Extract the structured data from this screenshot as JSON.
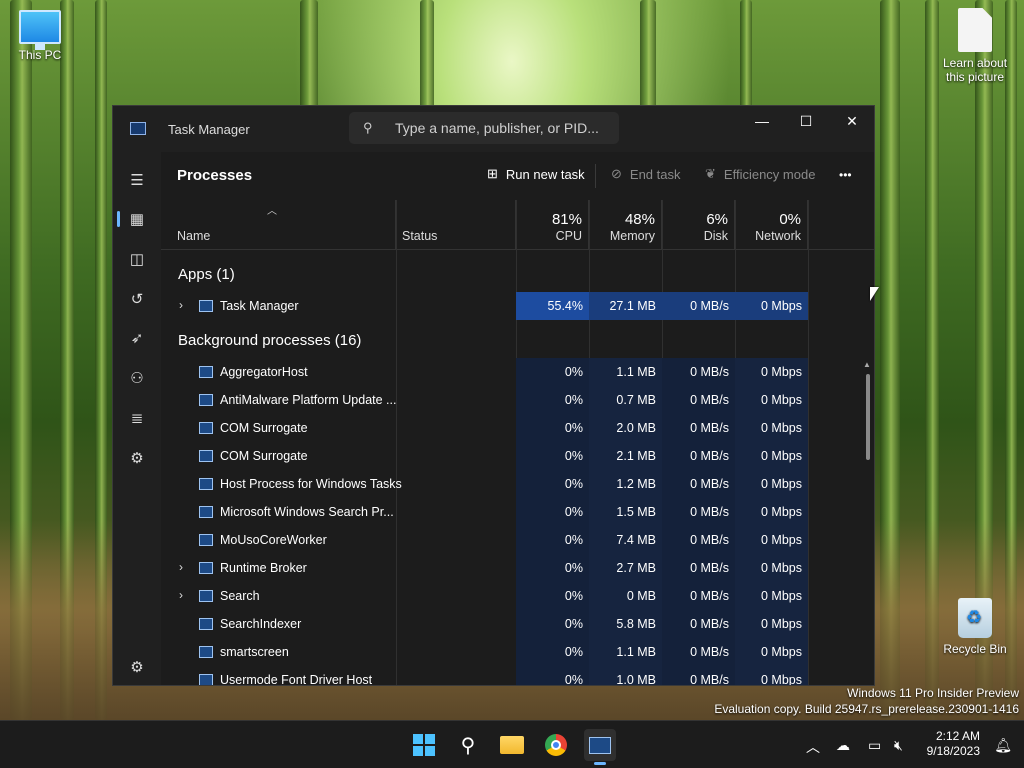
{
  "desktop": {
    "icons": [
      {
        "label": "This PC"
      },
      {
        "label": "Learn about this picture"
      },
      {
        "label": "Recycle Bin"
      }
    ],
    "watermark": {
      "line1": "Windows 11 Pro Insider Preview",
      "line2": "Evaluation copy. Build 25947.rs_prerelease.230901-1416"
    }
  },
  "window": {
    "title": "Task Manager",
    "search_placeholder": "Type a name, publisher, or PID...",
    "controls": {
      "minimize": "—",
      "maximize": "☐",
      "close": "✕"
    }
  },
  "sidebar": {
    "items": [
      {
        "name": "hamburger-icon",
        "glyph": "☰"
      },
      {
        "name": "processes-icon",
        "glyph": "▦"
      },
      {
        "name": "performance-icon",
        "glyph": "◫"
      },
      {
        "name": "app-history-icon",
        "glyph": "↺"
      },
      {
        "name": "startup-apps-icon",
        "glyph": "➶"
      },
      {
        "name": "users-icon",
        "glyph": "⚇"
      },
      {
        "name": "details-icon",
        "glyph": "≣"
      },
      {
        "name": "services-icon",
        "glyph": "⚙"
      }
    ],
    "settings_glyph": "⚙"
  },
  "toolbar": {
    "title": "Processes",
    "run_new_task": "Run new task",
    "end_task": "End task",
    "efficiency_mode": "Efficiency mode",
    "more": "•••"
  },
  "columns": {
    "name": "Name",
    "status": "Status",
    "cpu": {
      "pct": "81%",
      "label": "CPU"
    },
    "memory": {
      "pct": "48%",
      "label": "Memory"
    },
    "disk": {
      "pct": "6%",
      "label": "Disk"
    },
    "network": {
      "pct": "0%",
      "label": "Network"
    }
  },
  "groups": {
    "apps": "Apps (1)",
    "background": "Background processes (16)"
  },
  "apps": [
    {
      "name": "Task Manager",
      "cpu": "55.4%",
      "memory": "27.1 MB",
      "disk": "0 MB/s",
      "network": "0 Mbps",
      "expandable": true
    }
  ],
  "background": [
    {
      "name": "AggregatorHost",
      "cpu": "0%",
      "memory": "1.1 MB",
      "disk": "0 MB/s",
      "network": "0 Mbps",
      "expandable": false
    },
    {
      "name": "AntiMalware Platform Update ...",
      "cpu": "0%",
      "memory": "0.7 MB",
      "disk": "0 MB/s",
      "network": "0 Mbps",
      "expandable": false
    },
    {
      "name": "COM Surrogate",
      "cpu": "0%",
      "memory": "2.0 MB",
      "disk": "0 MB/s",
      "network": "0 Mbps",
      "expandable": false
    },
    {
      "name": "COM Surrogate",
      "cpu": "0%",
      "memory": "2.1 MB",
      "disk": "0 MB/s",
      "network": "0 Mbps",
      "expandable": false
    },
    {
      "name": "Host Process for Windows Tasks",
      "cpu": "0%",
      "memory": "1.2 MB",
      "disk": "0 MB/s",
      "network": "0 Mbps",
      "expandable": false
    },
    {
      "name": "Microsoft Windows Search Pr...",
      "cpu": "0%",
      "memory": "1.5 MB",
      "disk": "0 MB/s",
      "network": "0 Mbps",
      "expandable": false
    },
    {
      "name": "MoUsoCoreWorker",
      "cpu": "0%",
      "memory": "7.4 MB",
      "disk": "0 MB/s",
      "network": "0 Mbps",
      "expandable": false
    },
    {
      "name": "Runtime Broker",
      "cpu": "0%",
      "memory": "2.7 MB",
      "disk": "0 MB/s",
      "network": "0 Mbps",
      "expandable": true
    },
    {
      "name": "Search",
      "cpu": "0%",
      "memory": "0 MB",
      "disk": "0 MB/s",
      "network": "0 Mbps",
      "expandable": true
    },
    {
      "name": "SearchIndexer",
      "cpu": "0%",
      "memory": "5.8 MB",
      "disk": "0 MB/s",
      "network": "0 Mbps",
      "expandable": false
    },
    {
      "name": "smartscreen",
      "cpu": "0%",
      "memory": "1.1 MB",
      "disk": "0 MB/s",
      "network": "0 Mbps",
      "expandable": false
    },
    {
      "name": "Usermode Font Driver Host",
      "cpu": "0%",
      "memory": "1.0 MB",
      "disk": "0 MB/s",
      "network": "0 Mbps",
      "expandable": false
    }
  ],
  "taskbar": {
    "clock_time": "2:12 AM",
    "clock_date": "9/18/2023",
    "apps": [
      "start-icon",
      "search-icon",
      "file-explorer-icon",
      "chrome-icon",
      "task-manager-icon"
    ]
  },
  "colors": {
    "accent": "#6cb6ff",
    "cpu_highlight": "#1d4ca0"
  }
}
